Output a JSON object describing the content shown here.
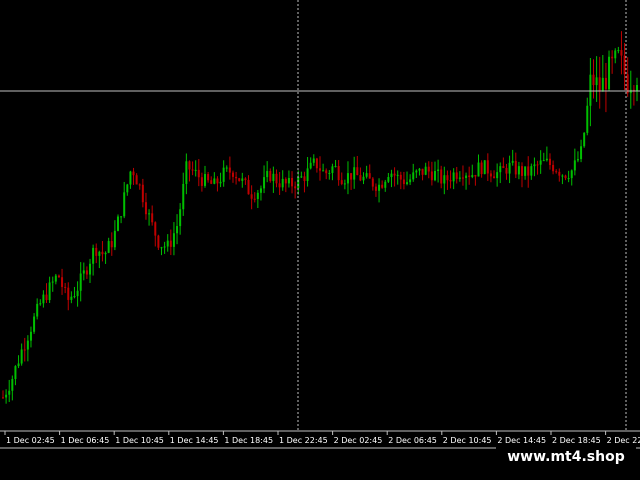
{
  "colors": {
    "background": "#000000",
    "bull": "#00c000",
    "bear": "#c00000",
    "grid": "#c0c0c0",
    "axis_text": "#ffffff",
    "crosshair": "#c0c0c0"
  },
  "watermark": "www.mt4.shop",
  "chart_data": {
    "type": "candlestick",
    "x_ticks": [
      "1 Dec 02:45",
      "1 Dec 06:45",
      "1 Dec 10:45",
      "1 Dec 14:45",
      "1 Dec 18:45",
      "1 Dec 22:45",
      "2 Dec 02:45",
      "2 Dec 06:45",
      "2 Dec 10:45",
      "2 Dec 14:45",
      "2 Dec 18:45",
      "2 Dec 22:"
    ],
    "grid": false,
    "crosshair": {
      "x_tick": "1 Dec 22:45"
    },
    "close_trace": [
      0.02,
      0.07,
      0.14,
      0.2,
      0.26,
      0.3,
      0.34,
      0.27,
      0.3,
      0.35,
      0.41,
      0.39,
      0.43,
      0.52,
      0.62,
      0.56,
      0.48,
      0.42,
      0.41,
      0.47,
      0.62,
      0.6,
      0.58,
      0.57,
      0.6,
      0.61,
      0.58,
      0.55,
      0.56,
      0.6,
      0.58,
      0.57,
      0.58,
      0.6,
      0.63,
      0.6,
      0.62,
      0.59,
      0.6,
      0.59,
      0.58,
      0.57,
      0.61,
      0.59,
      0.58,
      0.6,
      0.61,
      0.6,
      0.58,
      0.6,
      0.61,
      0.6,
      0.62,
      0.61,
      0.6,
      0.62,
      0.61,
      0.6,
      0.62,
      0.63,
      0.62,
      0.6,
      0.61,
      0.66,
      0.85,
      0.82,
      0.87,
      0.9,
      0.84,
      0.86
    ]
  }
}
